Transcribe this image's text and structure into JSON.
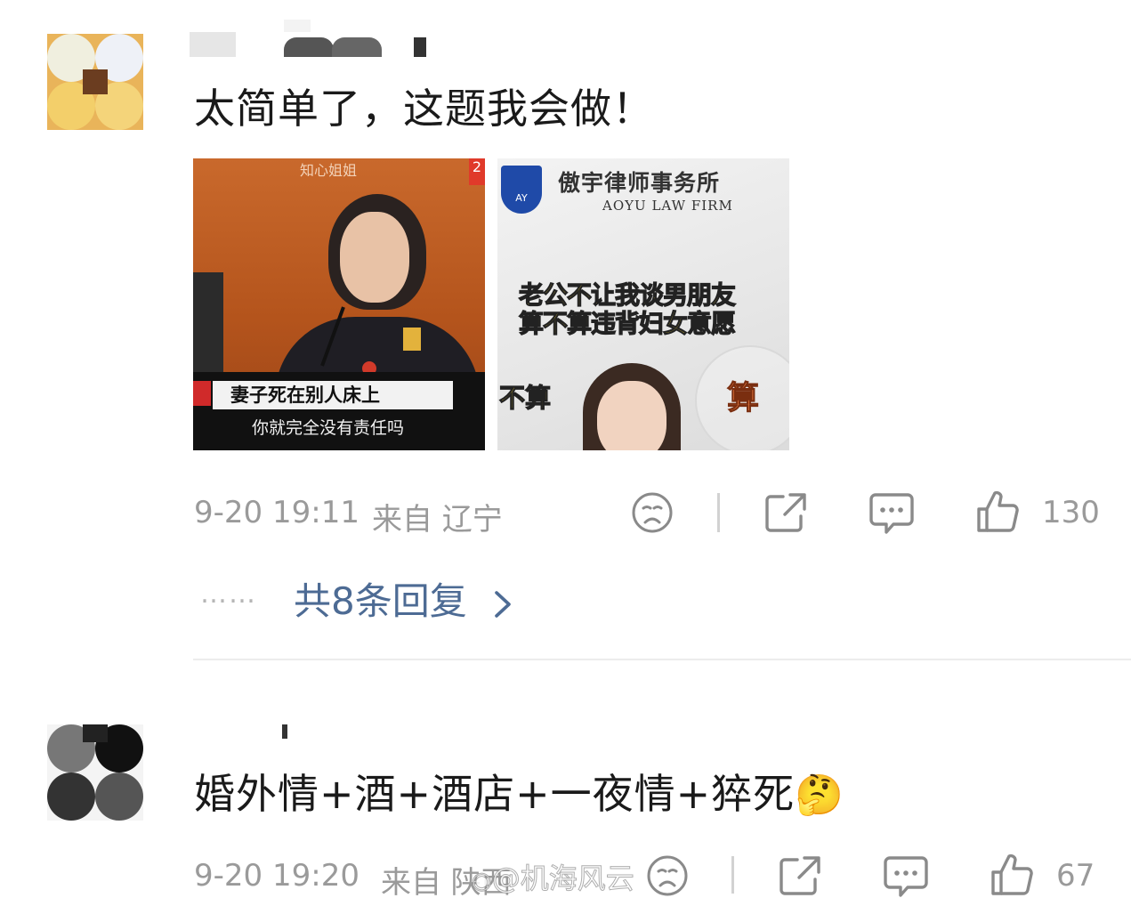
{
  "comments": [
    {
      "text": "太简单了，这题我会做！",
      "images": [
        {
          "watermark": "知心姐姐",
          "corner_mark": "2",
          "caption_line1": "妻子死在别人床上",
          "caption_line2": "你就完全没有责任吗"
        },
        {
          "firm_name": "傲宇律师事务所",
          "firm_name_en": "AOYU LAW FIRM",
          "badge": "AY",
          "headline_line1": "老公不让我谈男朋友",
          "headline_line2": "算不算违背妇女意愿",
          "option_left": "不算",
          "option_right": "算"
        }
      ],
      "time": "9-20 19:11",
      "location": "来自 辽宁",
      "like_count": "130",
      "replies_label": "共8条回复",
      "replies_dots": "……"
    },
    {
      "text": "婚外情+酒+酒店+一夜情+猝死",
      "emoji": "🤔",
      "time": "9-20 19:20",
      "location": "来自 陕西",
      "like_count": "67",
      "watermark": "@机海风云"
    }
  ],
  "icons": [
    "sad-face-icon",
    "share-icon",
    "comment-icon",
    "like-icon",
    "chevron-right-icon"
  ],
  "colors": {
    "link": "#4d6b94",
    "meta": "#9a9a9a",
    "text": "#1a1a1a",
    "caption_yellow": "#ffe23a"
  }
}
